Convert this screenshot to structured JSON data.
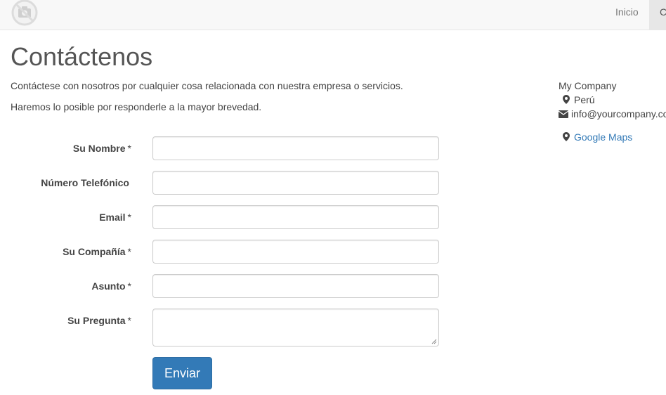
{
  "navbar": {
    "items": [
      {
        "label": "Inicio"
      },
      {
        "label": "Contáctenos"
      }
    ]
  },
  "page": {
    "title": "Contáctenos",
    "intro_1": "Contáctese con nosotros por cualquier cosa relacionada con nuestra empresa o servicios.",
    "intro_2": "Haremos lo posible por responderle a la mayor brevedad."
  },
  "form": {
    "fields": [
      {
        "label": "Su Nombre",
        "required": "*",
        "value": ""
      },
      {
        "label": "Número Telefónico",
        "required": "",
        "value": ""
      },
      {
        "label": "Email",
        "required": "*",
        "value": ""
      },
      {
        "label": "Su Compañía",
        "required": "*",
        "value": ""
      },
      {
        "label": "Asunto",
        "required": "*",
        "value": ""
      },
      {
        "label": "Su Pregunta",
        "required": "*",
        "value": ""
      }
    ],
    "submit_label": "Enviar"
  },
  "company": {
    "name": "My Company",
    "country": "Perú",
    "email": "info@yourcompany.com",
    "maps_label": "Google Maps"
  },
  "colors": {
    "primary": "#337ab7",
    "navbar_bg": "#f8f8f8"
  },
  "icons": {
    "logo": "camera-placeholder-icon",
    "location": "map-marker-icon",
    "email": "envelope-icon"
  }
}
